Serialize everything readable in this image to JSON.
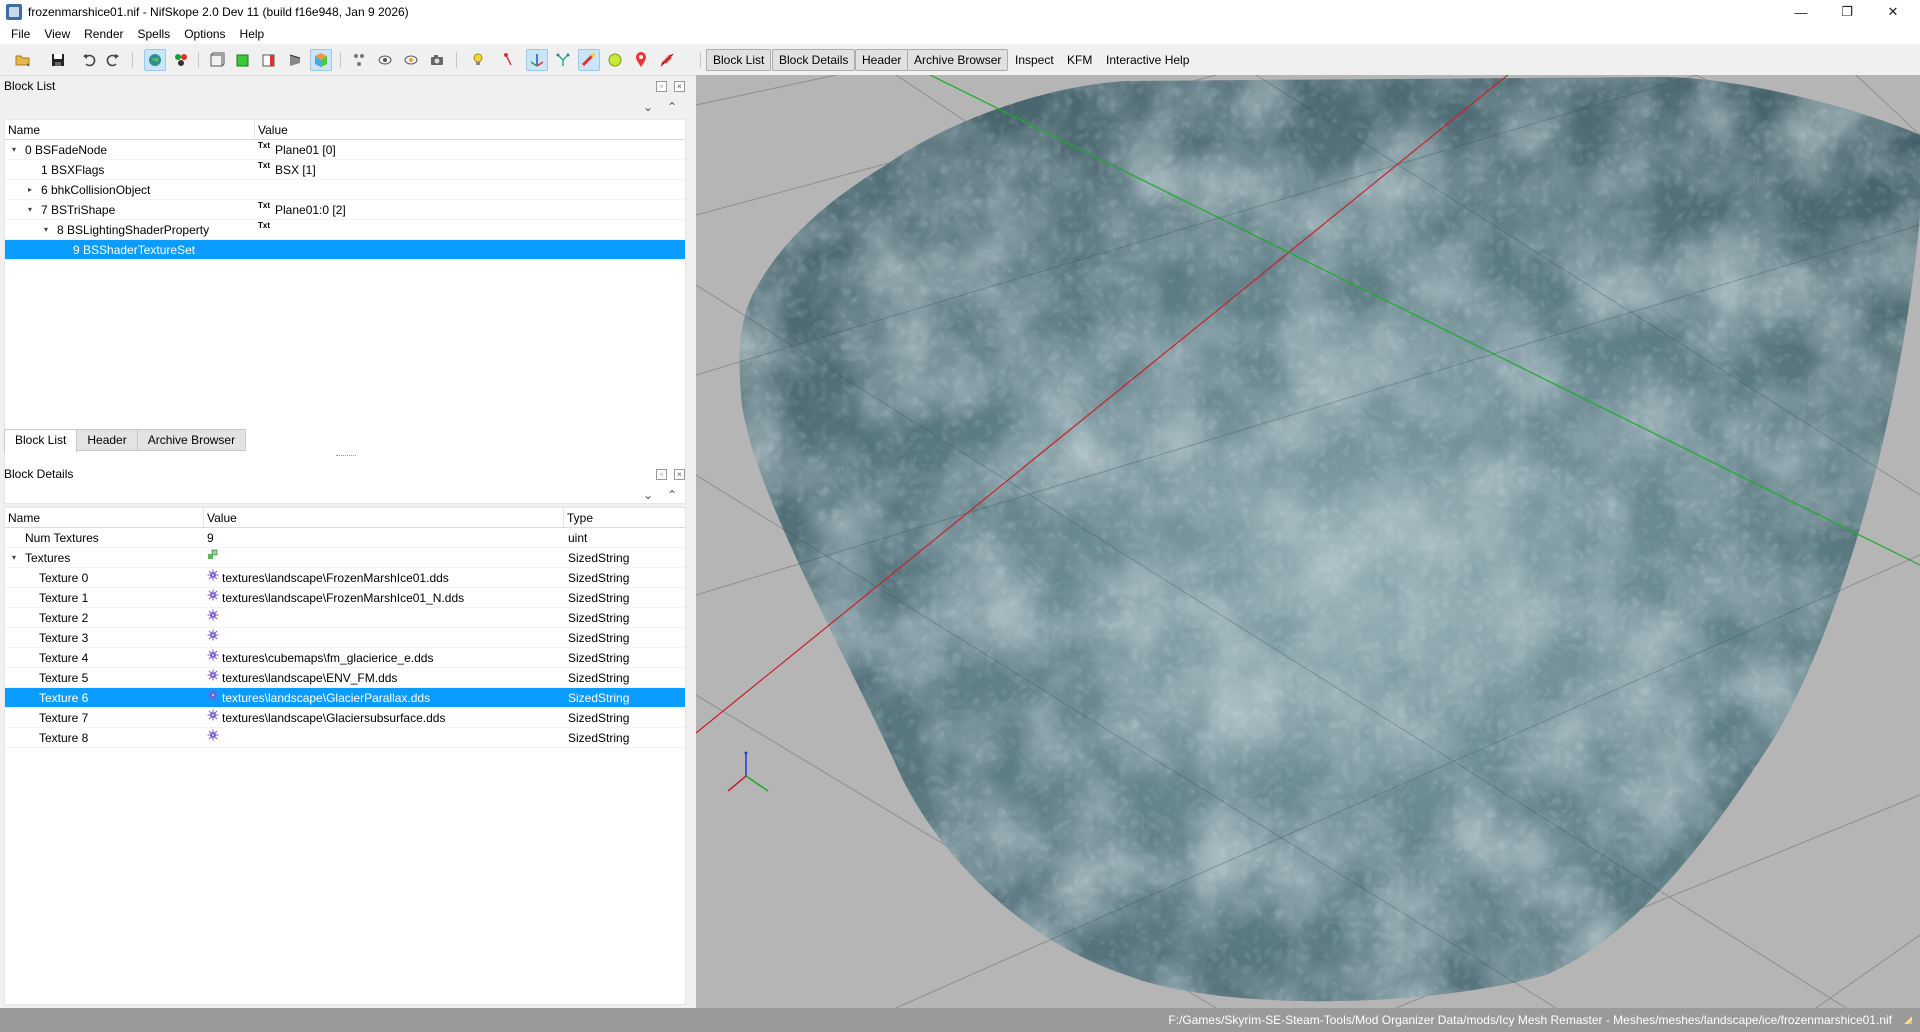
{
  "window": {
    "title": "frozenmarshice01.nif - NifSkope 2.0 Dev 11 (build f16e948, Jan  9 2026)",
    "minimize": "—",
    "maximize": "❐",
    "close": "✕"
  },
  "menu": [
    "File",
    "View",
    "Render",
    "Spells",
    "Options",
    "Help"
  ],
  "toolbar_tabs": [
    "Block List",
    "Block Details",
    "Header",
    "Archive Browser",
    "Inspect",
    "KFM",
    "Interactive Help"
  ],
  "block_list": {
    "title": "Block List",
    "columns": [
      "Name",
      "Value"
    ],
    "rows": [
      {
        "name": "0 BSFadeNode",
        "value": "Plane01 [0]",
        "badge": "Txt",
        "arrow": "▾",
        "indent": 0
      },
      {
        "name": "1 BSXFlags",
        "value": "BSX [1]",
        "badge": "Txt",
        "arrow": "",
        "indent": 1
      },
      {
        "name": "6 bhkCollisionObject",
        "value": "",
        "badge": "",
        "arrow": "▸",
        "indent": 1
      },
      {
        "name": "7 BSTriShape",
        "value": "Plane01:0 [2]",
        "badge": "Txt",
        "arrow": "▾",
        "indent": 1
      },
      {
        "name": "8 BSLightingShaderProperty",
        "value": "",
        "badge": "Txt",
        "arrow": "▾",
        "indent": 2
      },
      {
        "name": "9 BSShaderTextureSet",
        "value": "",
        "badge": "",
        "arrow": "",
        "indent": 3,
        "selected": true
      }
    ]
  },
  "tabs": [
    "Block List",
    "Header",
    "Archive Browser"
  ],
  "block_details": {
    "title": "Block Details",
    "columns": [
      "Name",
      "Value",
      "Type"
    ],
    "rows": [
      {
        "name": "Num Textures",
        "value": "9",
        "type": "uint",
        "icon": "",
        "arrow": "",
        "indent": 0
      },
      {
        "name": "Textures",
        "value": "",
        "type": "SizedString",
        "icon": "array",
        "arrow": "▾",
        "indent": 0
      },
      {
        "name": "Texture 0",
        "value": "textures\\landscape\\FrozenMarshIce01.dds",
        "type": "SizedString",
        "icon": "tex",
        "arrow": "",
        "indent": 1
      },
      {
        "name": "Texture 1",
        "value": "textures\\landscape\\FrozenMarshIce01_N.dds",
        "type": "SizedString",
        "icon": "tex",
        "arrow": "",
        "indent": 1
      },
      {
        "name": "Texture 2",
        "value": "",
        "type": "SizedString",
        "icon": "tex",
        "arrow": "",
        "indent": 1
      },
      {
        "name": "Texture 3",
        "value": "",
        "type": "SizedString",
        "icon": "tex",
        "arrow": "",
        "indent": 1
      },
      {
        "name": "Texture 4",
        "value": "textures\\cubemaps\\fm_glacierice_e.dds",
        "type": "SizedString",
        "icon": "tex",
        "arrow": "",
        "indent": 1
      },
      {
        "name": "Texture 5",
        "value": "textures\\landscape\\ENV_FM.dds",
        "type": "SizedString",
        "icon": "tex",
        "arrow": "",
        "indent": 1
      },
      {
        "name": "Texture 6",
        "value": "textures\\landscape\\GlacierParallax.dds",
        "type": "SizedString",
        "icon": "tex",
        "arrow": "",
        "indent": 1,
        "selected": true
      },
      {
        "name": "Texture 7",
        "value": "textures\\landscape\\Glaciersubsurface.dds",
        "type": "SizedString",
        "icon": "tex",
        "arrow": "",
        "indent": 1
      },
      {
        "name": "Texture 8",
        "value": "",
        "type": "SizedString",
        "icon": "tex",
        "arrow": "",
        "indent": 1
      }
    ]
  },
  "status": {
    "path": "F:/Games/Skyrim-SE-Steam-Tools/Mod Organizer Data/mods/Icy Mesh Remaster - Meshes/meshes/landscape/ice/frozenmarshice01.nif"
  },
  "colors": {
    "selection": "#0a9dff",
    "viewport_bg": "#b5b5b5",
    "axis_x": "#c8202a",
    "axis_y": "#1faa2c",
    "axis_z": "#1a3fd0"
  }
}
